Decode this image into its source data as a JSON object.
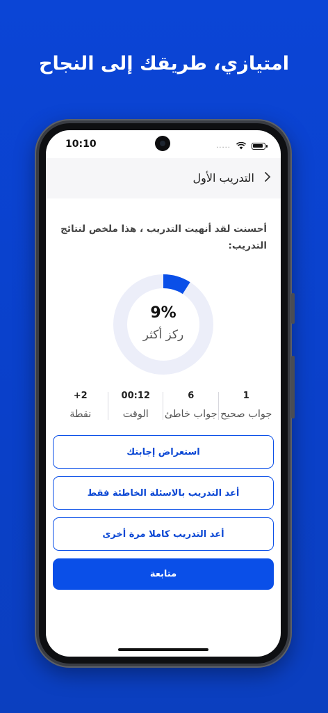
{
  "headline": "امتيازي، طريقك إلى النجاح",
  "status_bar": {
    "time": "10:10",
    "dots": "....."
  },
  "app_bar": {
    "title": "التدريب الأول"
  },
  "summary": "أحسنت لقد أنهيت التدريب ، هذا ملخص لنتائج التدريب:",
  "result": {
    "percentage": "9%",
    "percent_value": 9,
    "hint": "ركز أكثر"
  },
  "stats": [
    {
      "value": "1",
      "label": "جواب صحيح"
    },
    {
      "value": "6",
      "label": "جواب خاطئ"
    },
    {
      "value": "00:12",
      "label": "الوقت"
    },
    {
      "value": "+2",
      "label": "نقطة"
    }
  ],
  "buttons": {
    "review": "استعراض إجابتك",
    "retry_wrong": "أعد التدريب بالاسئلة الخاطئة فقط",
    "retry_all": "أعد التدريب كاملا مرة أخرى",
    "continue": "متابعة"
  },
  "colors": {
    "background": "#0b45d6",
    "primary": "#0a4fe8",
    "ring_track": "#eceef9"
  },
  "icons": {
    "back": "chevron-right-icon",
    "wifi": "wifi-icon",
    "battery": "battery-icon"
  }
}
